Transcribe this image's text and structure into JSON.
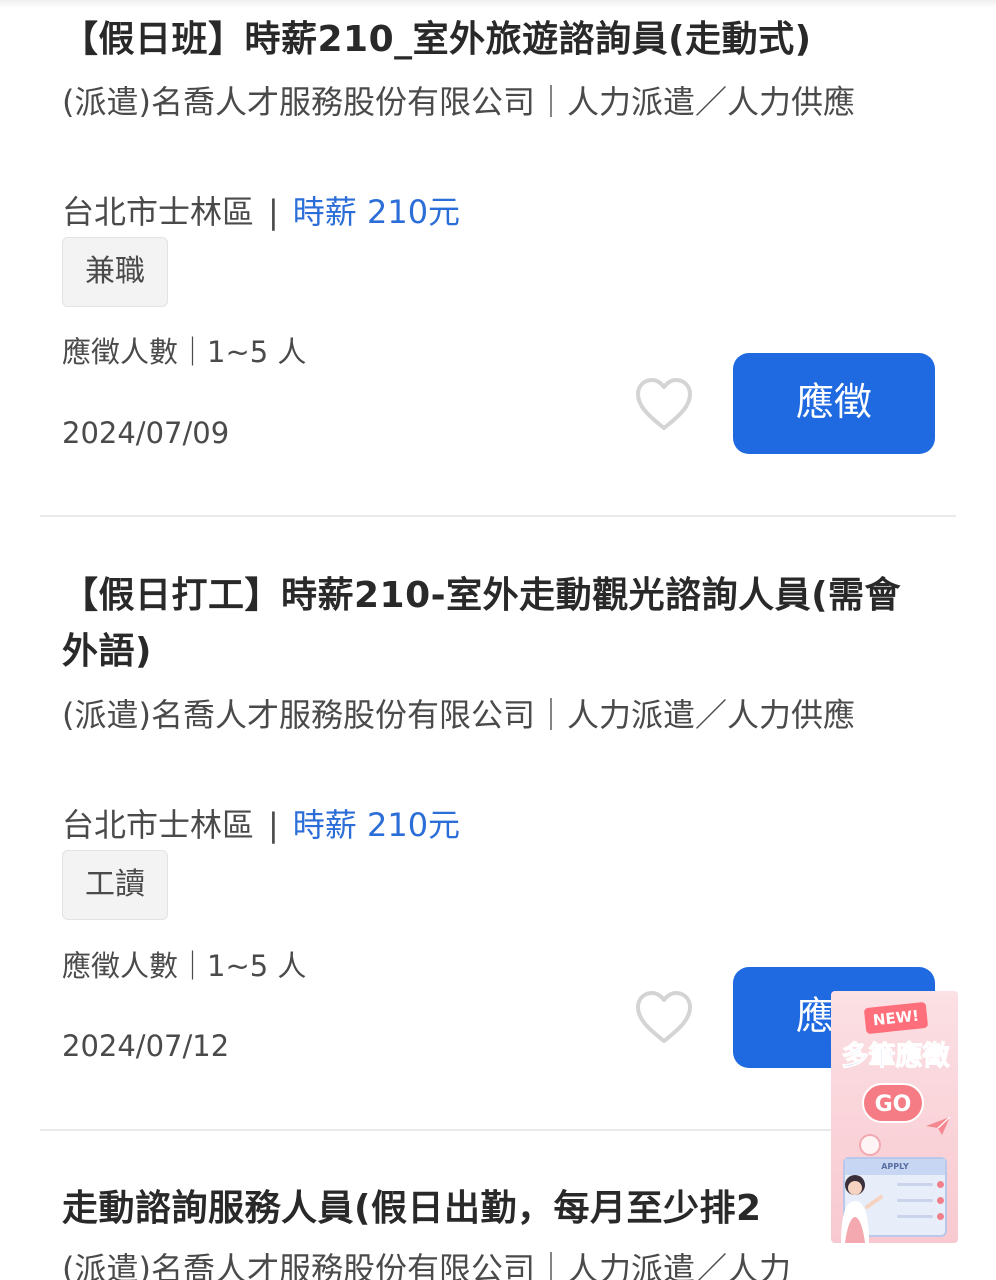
{
  "jobs": [
    {
      "title": "【假日班】時薪210_室外旅遊諮詢員(走動式)",
      "company": "(派遣)名喬人才服務股份有限公司｜人力派遣／人力供應",
      "location": "台北市士林區",
      "salary": "時薪 210元",
      "tag": "兼職",
      "applicants": "應徵人數｜1~5 人",
      "date": "2024/07/09",
      "apply_label": "應徵"
    },
    {
      "title": "【假日打工】時薪210-室外走動觀光諮詢人員(需會外語)",
      "company": "(派遣)名喬人才服務股份有限公司｜人力派遣／人力供應",
      "location": "台北市士林區",
      "salary": "時薪 210元",
      "tag": "工讀",
      "applicants": "應徵人數｜1~5 人",
      "date": "2024/07/12",
      "apply_label": "應徵"
    },
    {
      "title": "走動諮詢服務人員(假日出勤，每月至少排2",
      "company": "(派遣)名喬人才服務股份有限公司｜人力派遣／人力"
    }
  ],
  "separator": "|",
  "promo": {
    "badge": "NEW!",
    "title": "多筆應徵",
    "go_label": "GO",
    "board_label": "APPLY"
  },
  "colors": {
    "accent": "#1f6ae0",
    "salary": "#2c6ed8",
    "tag_bg": "#f3f3f3",
    "divider": "#e9e9e9"
  },
  "icons": [
    "heart-outline-icon",
    "paper-plane-icon",
    "clock-icon"
  ]
}
